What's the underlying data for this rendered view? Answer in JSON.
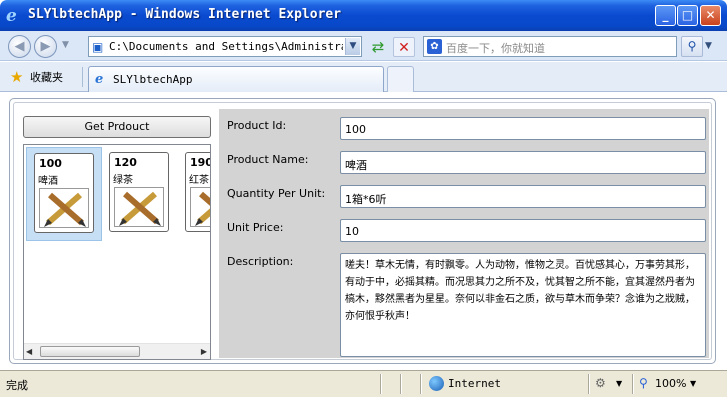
{
  "window": {
    "title": "SLYlbtechApp - Windows Internet Explorer",
    "min_glyph": "_",
    "max_glyph": "□",
    "close_glyph": "✕"
  },
  "address_bar": {
    "url": "C:\\Documents and Settings\\Administrator",
    "search_placeholder": "百度一下，你就知道"
  },
  "favorites": {
    "label": "收藏夹"
  },
  "tab": {
    "label": "SLYlbtechApp"
  },
  "app": {
    "get_button": "Get Prdouct",
    "products": [
      {
        "id": "100",
        "name": "啤酒"
      },
      {
        "id": "120",
        "name": "绿茶"
      },
      {
        "id": "190",
        "name": "红茶"
      }
    ],
    "details": {
      "product_id_label": "Product Id:",
      "product_id": "100",
      "product_name_label": "Product Name:",
      "product_name": "啤酒",
      "quantity_label": "Quantity Per Unit:",
      "quantity": "1箱*6听",
      "price_label": "Unit Price:",
      "price": "10",
      "description_label": "Description:",
      "description": "嗟夫！草木无情，有时飘零。人为动物，惟物之灵。百忧感其心，万事劳其形，有动于中，必摇其精。而况思其力之所不及，忧其智之所不能，宜其渥然丹者为槁木，黟然黑者为星星。奈何以非金石之质，欲与草木而争荣？念谁为之戕贼，亦何恨乎秋声！"
    }
  },
  "status_bar": {
    "status": "完成",
    "zone": "Internet",
    "zoom": "100%"
  }
}
